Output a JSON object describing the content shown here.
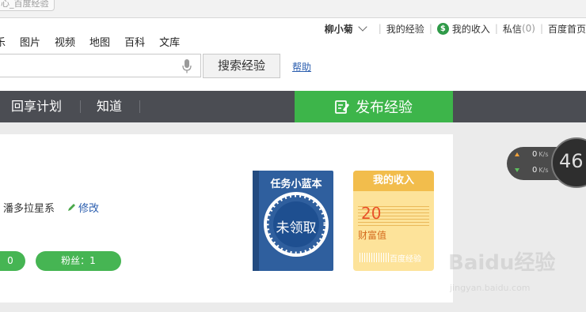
{
  "tab": {
    "title": "心_百度经验"
  },
  "userbar": {
    "username": "柳小菊",
    "my_experience": "我的经验",
    "my_income": "我的收入",
    "messages": "私信",
    "message_count": "(0)",
    "home": "百度首页"
  },
  "nav_links": [
    "乐",
    "图片",
    "视频",
    "地图",
    "百科",
    "文库"
  ],
  "search": {
    "placeholder": "",
    "button_label": "搜索经验",
    "help": "帮助"
  },
  "main_nav": {
    "items": [
      "回享计划",
      "知道"
    ],
    "publish": "发布经验"
  },
  "profile": {
    "location": "潘多拉星系",
    "edit": "修改",
    "stat1": "0",
    "fans": "粉丝：1"
  },
  "task_book": {
    "title": "任务小蓝本",
    "status": "未领取"
  },
  "income_book": {
    "title": "我的收入",
    "value": "20",
    "label": "财富值",
    "brand": "百度经验"
  },
  "speed_widget": {
    "up": "0",
    "down": "0",
    "unit": "K/s",
    "percent": "46"
  },
  "watermark": {
    "logo": "Baidu经验",
    "url": "jingyan.baidu.com"
  },
  "colors": {
    "accent_green": "#3db54a",
    "nav_bg": "#4b4d53",
    "task_blue": "#2f5f9e",
    "income_gold": "#f2bd4c"
  }
}
